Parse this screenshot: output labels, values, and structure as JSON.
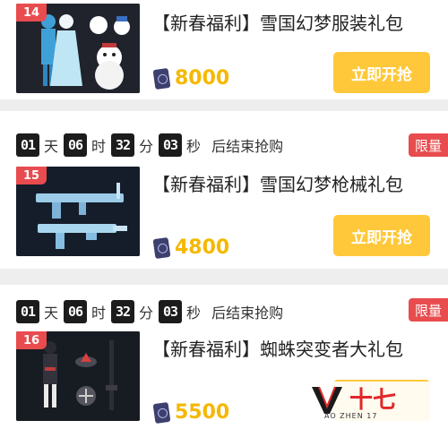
{
  "cards": [
    {
      "number": "14",
      "title": "【新春福利】雪国幻梦服装礼包",
      "price": "8000",
      "buy_label": "立即开抢"
    },
    {
      "number": "15",
      "timer": {
        "days": "01",
        "day_unit": "天",
        "hours": "06",
        "hour_unit": "时",
        "minutes": "32",
        "minute_unit": "分",
        "seconds": "03",
        "second_unit": "秒",
        "suffix": "后结束抢购"
      },
      "limited_label": "限量",
      "title": "【新春福利】雪国幻梦枪械礼包",
      "price": "4800",
      "buy_label": "立即开抢"
    },
    {
      "number": "16",
      "timer": {
        "days": "01",
        "day_unit": "天",
        "hours": "06",
        "hour_unit": "时",
        "minutes": "32",
        "minute_unit": "分",
        "seconds": "03",
        "second_unit": "秒",
        "suffix": "后结束抢购"
      },
      "limited_label": "限量",
      "title": "【新春福利】蜘蛛突变者大礼包",
      "price": "5500"
    }
  ],
  "watermark": {
    "text": "十七",
    "subtitle": "AO ZHEN 17"
  },
  "colors": {
    "accent_red": "#e84c4f",
    "button_yellow": "#ffc83a",
    "price_gold": "#f5b800",
    "timer_bg": "#1c1c1c"
  },
  "icons": {
    "currency": "coin-icon"
  }
}
